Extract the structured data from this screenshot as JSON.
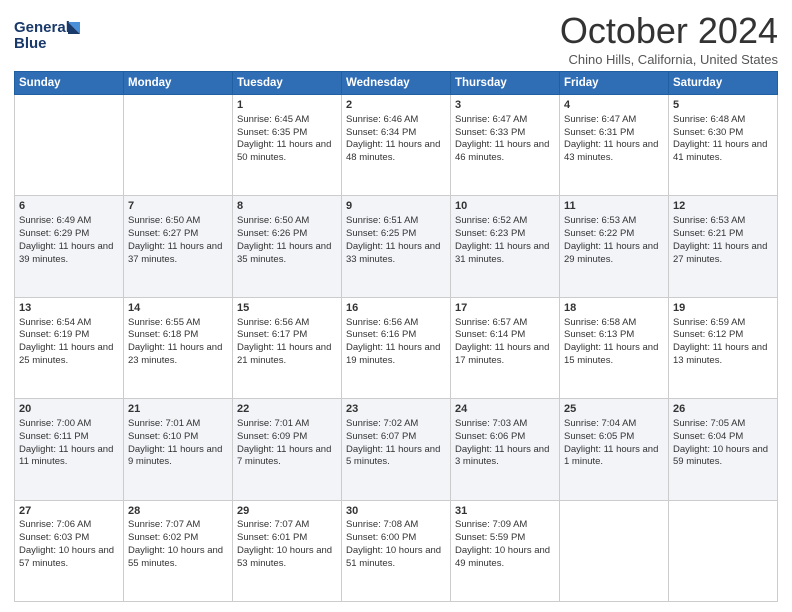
{
  "header": {
    "logo_line1": "General",
    "logo_line2": "Blue",
    "month": "October 2024",
    "location": "Chino Hills, California, United States"
  },
  "weekdays": [
    "Sunday",
    "Monday",
    "Tuesday",
    "Wednesday",
    "Thursday",
    "Friday",
    "Saturday"
  ],
  "weeks": [
    [
      {
        "day": "",
        "sunrise": "",
        "sunset": "",
        "daylight": ""
      },
      {
        "day": "",
        "sunrise": "",
        "sunset": "",
        "daylight": ""
      },
      {
        "day": "1",
        "sunrise": "Sunrise: 6:45 AM",
        "sunset": "Sunset: 6:35 PM",
        "daylight": "Daylight: 11 hours and 50 minutes."
      },
      {
        "day": "2",
        "sunrise": "Sunrise: 6:46 AM",
        "sunset": "Sunset: 6:34 PM",
        "daylight": "Daylight: 11 hours and 48 minutes."
      },
      {
        "day": "3",
        "sunrise": "Sunrise: 6:47 AM",
        "sunset": "Sunset: 6:33 PM",
        "daylight": "Daylight: 11 hours and 46 minutes."
      },
      {
        "day": "4",
        "sunrise": "Sunrise: 6:47 AM",
        "sunset": "Sunset: 6:31 PM",
        "daylight": "Daylight: 11 hours and 43 minutes."
      },
      {
        "day": "5",
        "sunrise": "Sunrise: 6:48 AM",
        "sunset": "Sunset: 6:30 PM",
        "daylight": "Daylight: 11 hours and 41 minutes."
      }
    ],
    [
      {
        "day": "6",
        "sunrise": "Sunrise: 6:49 AM",
        "sunset": "Sunset: 6:29 PM",
        "daylight": "Daylight: 11 hours and 39 minutes."
      },
      {
        "day": "7",
        "sunrise": "Sunrise: 6:50 AM",
        "sunset": "Sunset: 6:27 PM",
        "daylight": "Daylight: 11 hours and 37 minutes."
      },
      {
        "day": "8",
        "sunrise": "Sunrise: 6:50 AM",
        "sunset": "Sunset: 6:26 PM",
        "daylight": "Daylight: 11 hours and 35 minutes."
      },
      {
        "day": "9",
        "sunrise": "Sunrise: 6:51 AM",
        "sunset": "Sunset: 6:25 PM",
        "daylight": "Daylight: 11 hours and 33 minutes."
      },
      {
        "day": "10",
        "sunrise": "Sunrise: 6:52 AM",
        "sunset": "Sunset: 6:23 PM",
        "daylight": "Daylight: 11 hours and 31 minutes."
      },
      {
        "day": "11",
        "sunrise": "Sunrise: 6:53 AM",
        "sunset": "Sunset: 6:22 PM",
        "daylight": "Daylight: 11 hours and 29 minutes."
      },
      {
        "day": "12",
        "sunrise": "Sunrise: 6:53 AM",
        "sunset": "Sunset: 6:21 PM",
        "daylight": "Daylight: 11 hours and 27 minutes."
      }
    ],
    [
      {
        "day": "13",
        "sunrise": "Sunrise: 6:54 AM",
        "sunset": "Sunset: 6:19 PM",
        "daylight": "Daylight: 11 hours and 25 minutes."
      },
      {
        "day": "14",
        "sunrise": "Sunrise: 6:55 AM",
        "sunset": "Sunset: 6:18 PM",
        "daylight": "Daylight: 11 hours and 23 minutes."
      },
      {
        "day": "15",
        "sunrise": "Sunrise: 6:56 AM",
        "sunset": "Sunset: 6:17 PM",
        "daylight": "Daylight: 11 hours and 21 minutes."
      },
      {
        "day": "16",
        "sunrise": "Sunrise: 6:56 AM",
        "sunset": "Sunset: 6:16 PM",
        "daylight": "Daylight: 11 hours and 19 minutes."
      },
      {
        "day": "17",
        "sunrise": "Sunrise: 6:57 AM",
        "sunset": "Sunset: 6:14 PM",
        "daylight": "Daylight: 11 hours and 17 minutes."
      },
      {
        "day": "18",
        "sunrise": "Sunrise: 6:58 AM",
        "sunset": "Sunset: 6:13 PM",
        "daylight": "Daylight: 11 hours and 15 minutes."
      },
      {
        "day": "19",
        "sunrise": "Sunrise: 6:59 AM",
        "sunset": "Sunset: 6:12 PM",
        "daylight": "Daylight: 11 hours and 13 minutes."
      }
    ],
    [
      {
        "day": "20",
        "sunrise": "Sunrise: 7:00 AM",
        "sunset": "Sunset: 6:11 PM",
        "daylight": "Daylight: 11 hours and 11 minutes."
      },
      {
        "day": "21",
        "sunrise": "Sunrise: 7:01 AM",
        "sunset": "Sunset: 6:10 PM",
        "daylight": "Daylight: 11 hours and 9 minutes."
      },
      {
        "day": "22",
        "sunrise": "Sunrise: 7:01 AM",
        "sunset": "Sunset: 6:09 PM",
        "daylight": "Daylight: 11 hours and 7 minutes."
      },
      {
        "day": "23",
        "sunrise": "Sunrise: 7:02 AM",
        "sunset": "Sunset: 6:07 PM",
        "daylight": "Daylight: 11 hours and 5 minutes."
      },
      {
        "day": "24",
        "sunrise": "Sunrise: 7:03 AM",
        "sunset": "Sunset: 6:06 PM",
        "daylight": "Daylight: 11 hours and 3 minutes."
      },
      {
        "day": "25",
        "sunrise": "Sunrise: 7:04 AM",
        "sunset": "Sunset: 6:05 PM",
        "daylight": "Daylight: 11 hours and 1 minute."
      },
      {
        "day": "26",
        "sunrise": "Sunrise: 7:05 AM",
        "sunset": "Sunset: 6:04 PM",
        "daylight": "Daylight: 10 hours and 59 minutes."
      }
    ],
    [
      {
        "day": "27",
        "sunrise": "Sunrise: 7:06 AM",
        "sunset": "Sunset: 6:03 PM",
        "daylight": "Daylight: 10 hours and 57 minutes."
      },
      {
        "day": "28",
        "sunrise": "Sunrise: 7:07 AM",
        "sunset": "Sunset: 6:02 PM",
        "daylight": "Daylight: 10 hours and 55 minutes."
      },
      {
        "day": "29",
        "sunrise": "Sunrise: 7:07 AM",
        "sunset": "Sunset: 6:01 PM",
        "daylight": "Daylight: 10 hours and 53 minutes."
      },
      {
        "day": "30",
        "sunrise": "Sunrise: 7:08 AM",
        "sunset": "Sunset: 6:00 PM",
        "daylight": "Daylight: 10 hours and 51 minutes."
      },
      {
        "day": "31",
        "sunrise": "Sunrise: 7:09 AM",
        "sunset": "Sunset: 5:59 PM",
        "daylight": "Daylight: 10 hours and 49 minutes."
      },
      {
        "day": "",
        "sunrise": "",
        "sunset": "",
        "daylight": ""
      },
      {
        "day": "",
        "sunrise": "",
        "sunset": "",
        "daylight": ""
      }
    ]
  ]
}
